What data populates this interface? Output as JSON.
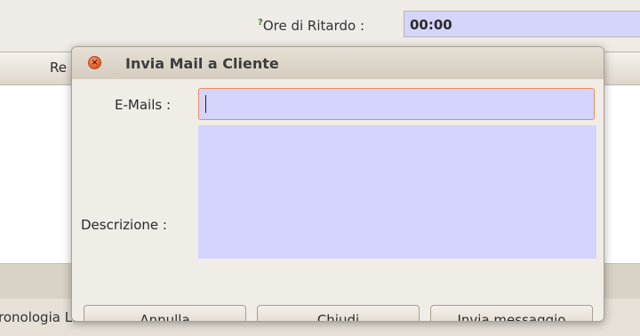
{
  "background": {
    "delay_label_mark": "?",
    "delay_label": "Ore di Ritardo :",
    "delay_value": "00:00",
    "tab_left_label": "Re",
    "bottom_tab_label": "ronologia Lavoro"
  },
  "dialog": {
    "title": "Invia Mail a Cliente",
    "close_icon": "close-icon",
    "emails_label": "E-Mails :",
    "emails_value": "",
    "description_label": "Descrizione :",
    "description_value": "",
    "buttons": {
      "cancel": "Annulla",
      "close": "Chiudi",
      "send": "Invia messaggio"
    }
  },
  "colors": {
    "input_bg": "#d4d4fd",
    "focus_border": "#f08a60",
    "close_button": "#e0551f",
    "window_bg": "#f0ece6"
  }
}
